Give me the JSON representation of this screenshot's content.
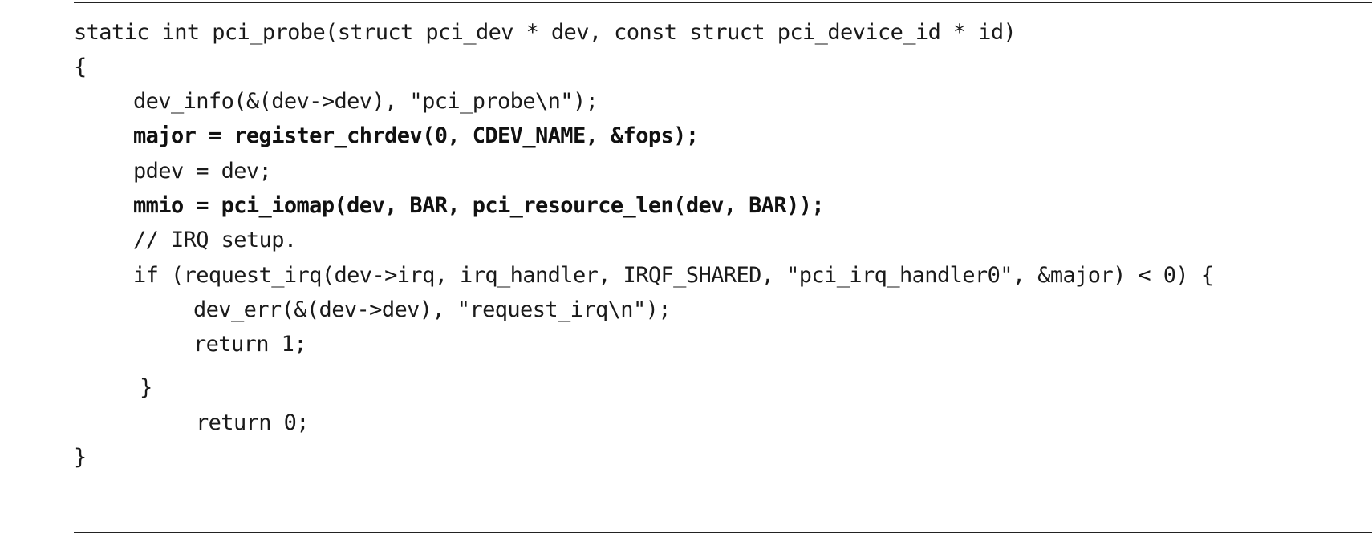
{
  "code_listing": {
    "lines": [
      "static int pci_probe(struct pci_dev * dev, const struct pci_device_id * id)",
      "{",
      "dev_info(&(dev->dev), \"pci_probe\\n\");",
      "major = register_chrdev(0, CDEV_NAME, &fops);",
      "pdev = dev;",
      "mmio = pci_iomap(dev, BAR, pci_resource_len(dev, BAR));",
      "// IRQ setup.",
      "if (request_irq(dev->irq, irq_handler, IRQF_SHARED, \"pci_irq_handler0\", &major) < 0) {",
      "dev_err(&(dev->dev), \"request_irq\\n\");",
      "return 1;",
      "}",
      "return 0;",
      "}"
    ]
  }
}
